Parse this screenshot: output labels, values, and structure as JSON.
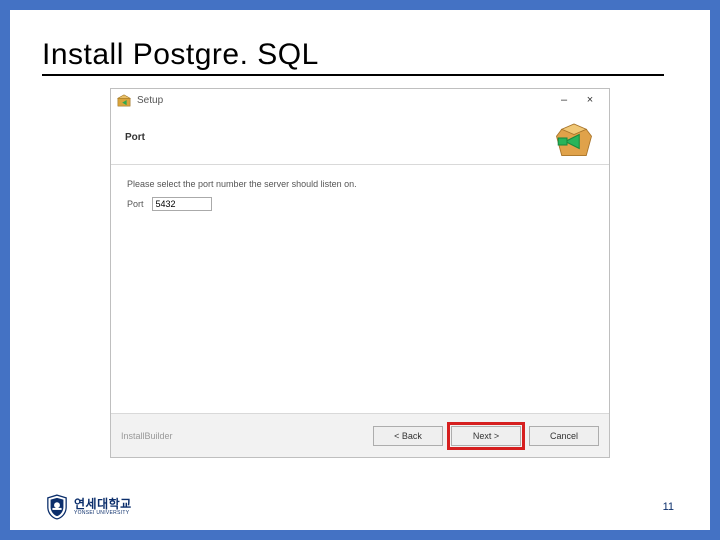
{
  "slide": {
    "title": "Install Postgre. SQL",
    "page_number": "11"
  },
  "installer": {
    "titlebar": {
      "app_title": "Setup",
      "minimize": "–",
      "close": "×"
    },
    "header": {
      "title": "Port"
    },
    "content": {
      "instruction": "Please select the port number the server should listen on.",
      "port_label": "Port",
      "port_value": "5432"
    },
    "footer": {
      "brand": "InstallBuilder",
      "back": "< Back",
      "next": "Next >",
      "cancel": "Cancel"
    }
  },
  "university": {
    "korean": "연세대학교",
    "english": "YONSEI UNIVERSITY"
  }
}
